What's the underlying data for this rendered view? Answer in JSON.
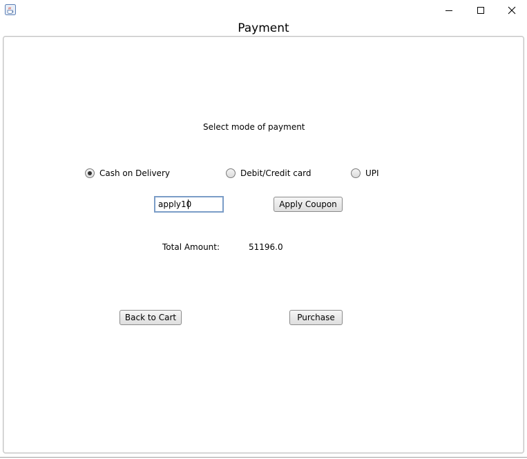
{
  "window": {
    "icon": "java-coffee-cup-icon",
    "controls": {
      "minimize": "minimize-icon",
      "maximize": "maximize-icon",
      "close": "close-icon"
    }
  },
  "frame": {
    "title": "Payment"
  },
  "form": {
    "prompt": "Select mode of payment",
    "payment_options": [
      {
        "label": "Cash on Delivery",
        "selected": true
      },
      {
        "label": "Debit/Credit card",
        "selected": false
      },
      {
        "label": "UPI",
        "selected": false
      }
    ],
    "coupon": {
      "value": "apply10",
      "button_label": "Apply Coupon"
    },
    "total": {
      "label": "Total Amount:",
      "value": "51196.0"
    },
    "actions": {
      "back_label": "Back to Cart",
      "purchase_label": "Purchase"
    }
  },
  "colors": {
    "focus_border": "#7a9cc7",
    "panel_border": "#c4c4c4"
  }
}
